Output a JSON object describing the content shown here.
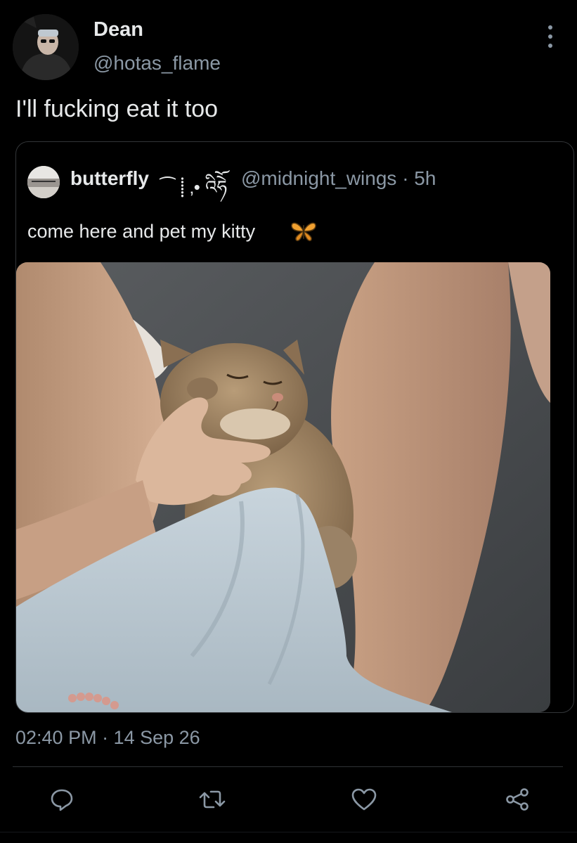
{
  "tweet": {
    "author_name": "Dean",
    "author_handle": "@hotas_flame",
    "text": "I'll fucking eat it too",
    "timestamp": "02:40 PM · 14 Sep 26"
  },
  "quote": {
    "name": "butterfly",
    "name_decoration": "⁀ ⸽ ‚• འིཧེོ",
    "handle_time": "@midnight_wings · 5h",
    "text": "come here and pet my kitty",
    "emoji": "butterfly-icon"
  },
  "actions": [
    "reply-icon",
    "retweet-icon",
    "like-icon",
    "share-icon"
  ],
  "colors": {
    "background": "#000000",
    "text": "#e7e9ea",
    "secondary": "#8b98a5",
    "border": "#333639"
  }
}
